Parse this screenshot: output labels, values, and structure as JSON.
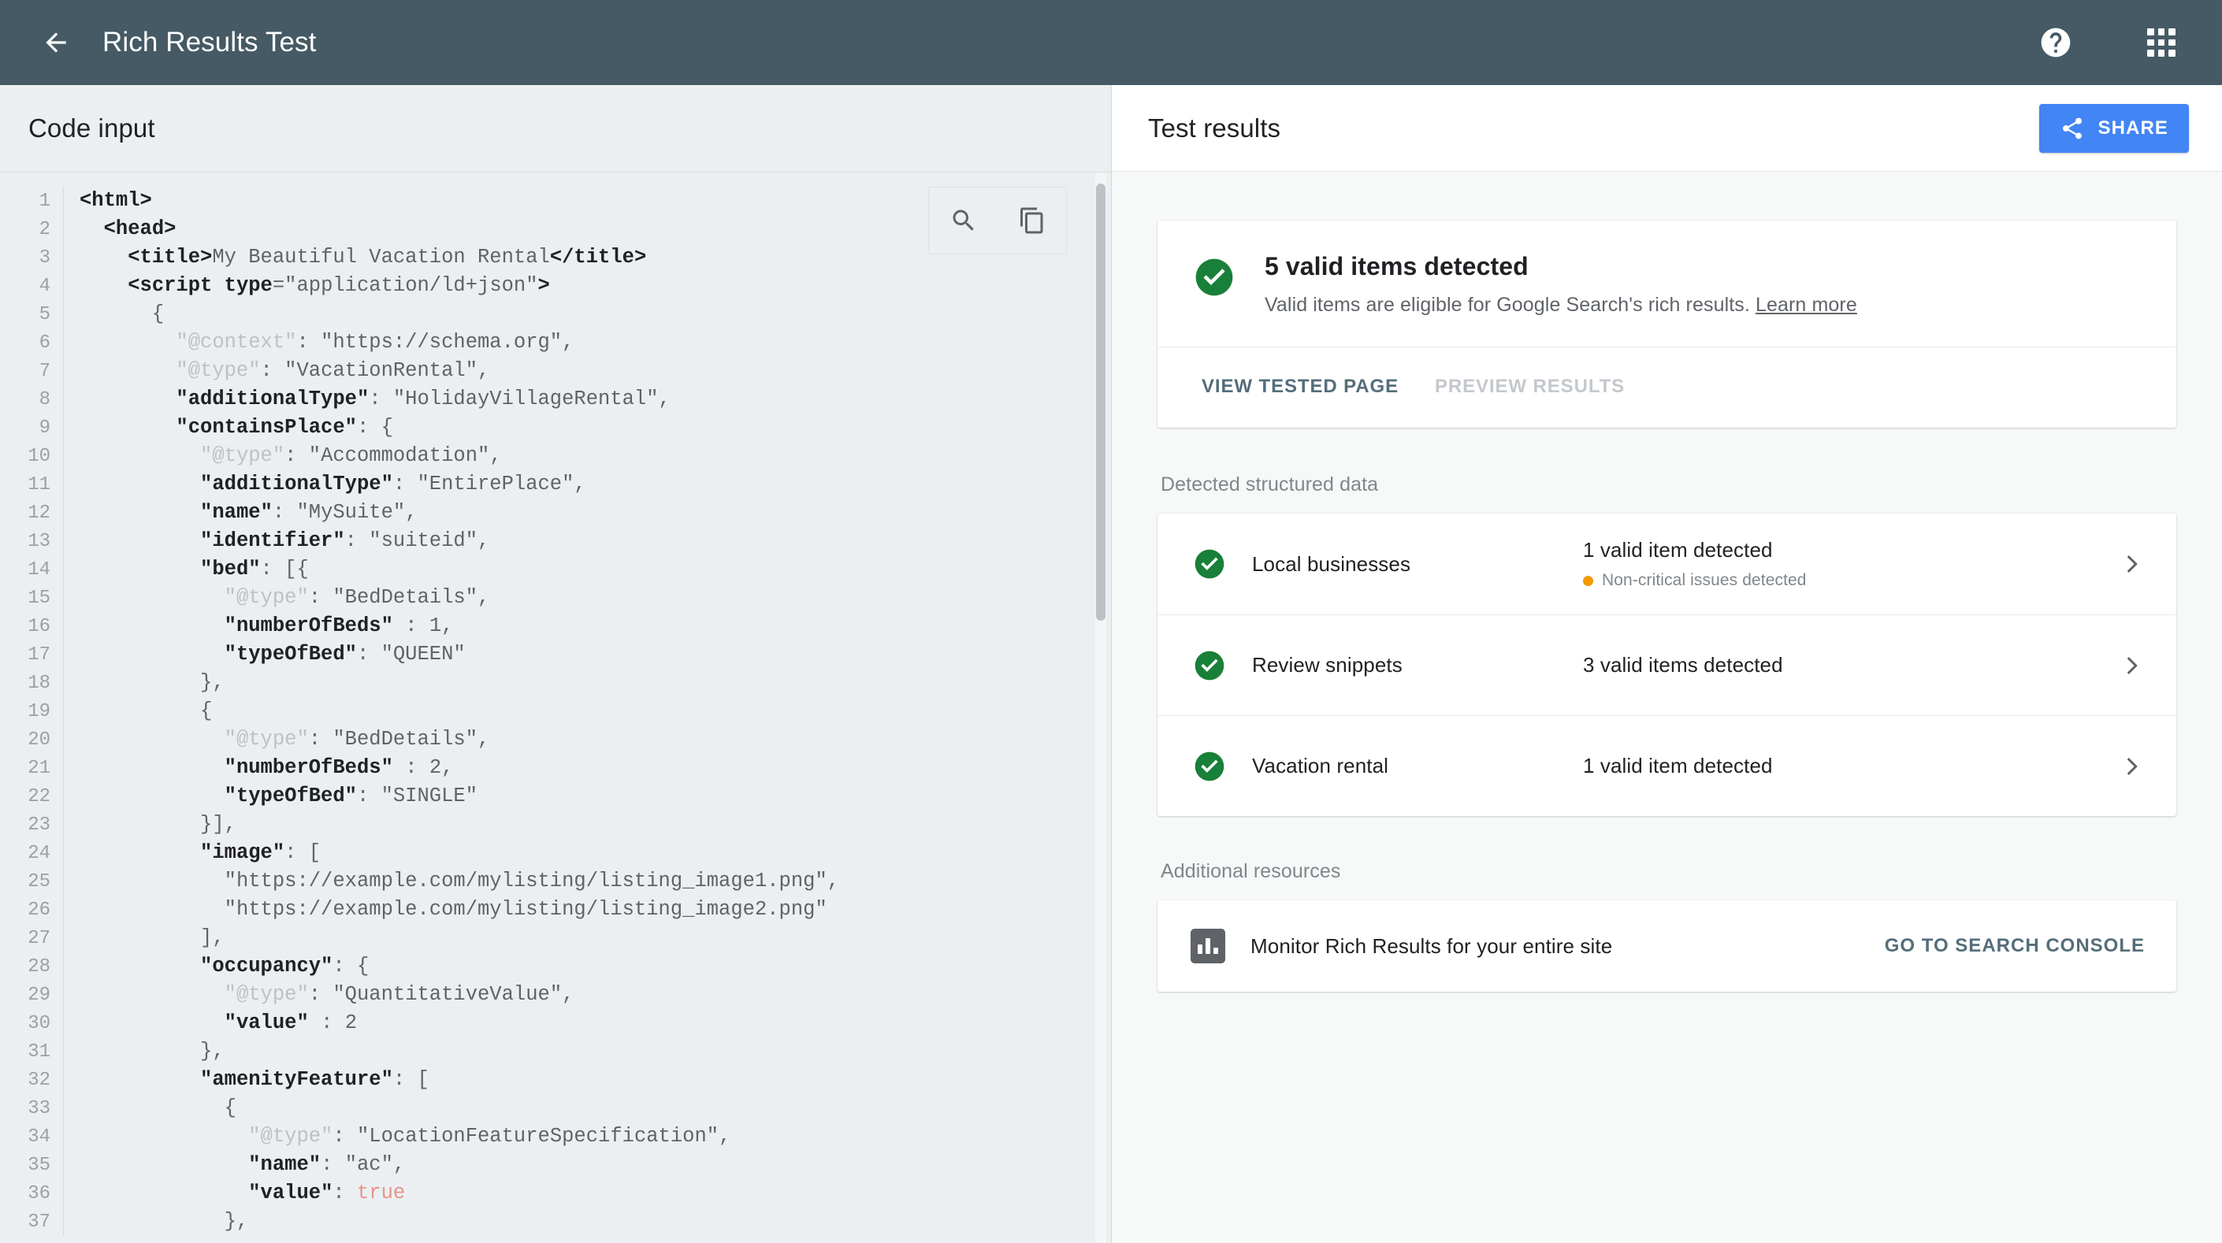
{
  "topbar": {
    "back_icon": "arrow-left-icon",
    "title": "Rich Results Test",
    "help_icon": "help-icon",
    "apps_icon": "apps-grid-icon"
  },
  "code_panel": {
    "header": "Code input",
    "toolbar": {
      "search_icon": "search-icon",
      "copy_icon": "copy-icon"
    },
    "lines": [
      {
        "n": "1",
        "tokens": [
          {
            "t": "tag",
            "v": "<html>"
          }
        ]
      },
      {
        "n": "2",
        "tokens": [
          {
            "t": "plain",
            "v": "  "
          },
          {
            "t": "tag",
            "v": "<head>"
          }
        ]
      },
      {
        "n": "3",
        "tokens": [
          {
            "t": "plain",
            "v": "    "
          },
          {
            "t": "tag",
            "v": "<title>"
          },
          {
            "t": "str",
            "v": "My Beautiful Vacation Rental"
          },
          {
            "t": "tag",
            "v": "</title>"
          }
        ]
      },
      {
        "n": "4",
        "tokens": [
          {
            "t": "plain",
            "v": "    "
          },
          {
            "t": "tag",
            "v": "<script "
          },
          {
            "t": "attr",
            "v": "type"
          },
          {
            "t": "plain",
            "v": "="
          },
          {
            "t": "str",
            "v": "\"application/ld+json\""
          },
          {
            "t": "tag",
            "v": ">"
          }
        ]
      },
      {
        "n": "5",
        "tokens": [
          {
            "t": "plain",
            "v": "      {"
          }
        ]
      },
      {
        "n": "6",
        "tokens": [
          {
            "t": "plain",
            "v": "        "
          },
          {
            "t": "meta",
            "v": "\"@context\""
          },
          {
            "t": "plain",
            "v": ": "
          },
          {
            "t": "str",
            "v": "\"https://schema.org\""
          },
          {
            "t": "plain",
            "v": ","
          }
        ]
      },
      {
        "n": "7",
        "tokens": [
          {
            "t": "plain",
            "v": "        "
          },
          {
            "t": "meta",
            "v": "\"@type\""
          },
          {
            "t": "plain",
            "v": ": "
          },
          {
            "t": "str",
            "v": "\"VacationRental\""
          },
          {
            "t": "plain",
            "v": ","
          }
        ]
      },
      {
        "n": "8",
        "tokens": [
          {
            "t": "plain",
            "v": "        "
          },
          {
            "t": "key",
            "v": "\"additionalType\""
          },
          {
            "t": "plain",
            "v": ": "
          },
          {
            "t": "str",
            "v": "\"HolidayVillageRental\""
          },
          {
            "t": "plain",
            "v": ","
          }
        ]
      },
      {
        "n": "9",
        "tokens": [
          {
            "t": "plain",
            "v": "        "
          },
          {
            "t": "key",
            "v": "\"containsPlace\""
          },
          {
            "t": "plain",
            "v": ": {"
          }
        ]
      },
      {
        "n": "10",
        "tokens": [
          {
            "t": "plain",
            "v": "          "
          },
          {
            "t": "meta",
            "v": "\"@type\""
          },
          {
            "t": "plain",
            "v": ": "
          },
          {
            "t": "str",
            "v": "\"Accommodation\""
          },
          {
            "t": "plain",
            "v": ","
          }
        ]
      },
      {
        "n": "11",
        "tokens": [
          {
            "t": "plain",
            "v": "          "
          },
          {
            "t": "key",
            "v": "\"additionalType\""
          },
          {
            "t": "plain",
            "v": ": "
          },
          {
            "t": "str",
            "v": "\"EntirePlace\""
          },
          {
            "t": "plain",
            "v": ","
          }
        ]
      },
      {
        "n": "12",
        "tokens": [
          {
            "t": "plain",
            "v": "          "
          },
          {
            "t": "key",
            "v": "\"name\""
          },
          {
            "t": "plain",
            "v": ": "
          },
          {
            "t": "str",
            "v": "\"MySuite\""
          },
          {
            "t": "plain",
            "v": ","
          }
        ]
      },
      {
        "n": "13",
        "tokens": [
          {
            "t": "plain",
            "v": "          "
          },
          {
            "t": "key",
            "v": "\"identifier\""
          },
          {
            "t": "plain",
            "v": ": "
          },
          {
            "t": "str",
            "v": "\"suiteid\""
          },
          {
            "t": "plain",
            "v": ","
          }
        ]
      },
      {
        "n": "14",
        "tokens": [
          {
            "t": "plain",
            "v": "          "
          },
          {
            "t": "key",
            "v": "\"bed\""
          },
          {
            "t": "plain",
            "v": ": [{"
          }
        ]
      },
      {
        "n": "15",
        "tokens": [
          {
            "t": "plain",
            "v": "            "
          },
          {
            "t": "meta",
            "v": "\"@type\""
          },
          {
            "t": "plain",
            "v": ": "
          },
          {
            "t": "str",
            "v": "\"BedDetails\""
          },
          {
            "t": "plain",
            "v": ","
          }
        ]
      },
      {
        "n": "16",
        "tokens": [
          {
            "t": "plain",
            "v": "            "
          },
          {
            "t": "key",
            "v": "\"numberOfBeds\""
          },
          {
            "t": "plain",
            "v": " : "
          },
          {
            "t": "num",
            "v": "1"
          },
          {
            "t": "plain",
            "v": ","
          }
        ]
      },
      {
        "n": "17",
        "tokens": [
          {
            "t": "plain",
            "v": "            "
          },
          {
            "t": "key",
            "v": "\"typeOfBed\""
          },
          {
            "t": "plain",
            "v": ": "
          },
          {
            "t": "str",
            "v": "\"QUEEN\""
          }
        ]
      },
      {
        "n": "18",
        "tokens": [
          {
            "t": "plain",
            "v": "          },"
          }
        ]
      },
      {
        "n": "19",
        "tokens": [
          {
            "t": "plain",
            "v": "          {"
          }
        ]
      },
      {
        "n": "20",
        "tokens": [
          {
            "t": "plain",
            "v": "            "
          },
          {
            "t": "meta",
            "v": "\"@type\""
          },
          {
            "t": "plain",
            "v": ": "
          },
          {
            "t": "str",
            "v": "\"BedDetails\""
          },
          {
            "t": "plain",
            "v": ","
          }
        ]
      },
      {
        "n": "21",
        "tokens": [
          {
            "t": "plain",
            "v": "            "
          },
          {
            "t": "key",
            "v": "\"numberOfBeds\""
          },
          {
            "t": "plain",
            "v": " : "
          },
          {
            "t": "num",
            "v": "2"
          },
          {
            "t": "plain",
            "v": ","
          }
        ]
      },
      {
        "n": "22",
        "tokens": [
          {
            "t": "plain",
            "v": "            "
          },
          {
            "t": "key",
            "v": "\"typeOfBed\""
          },
          {
            "t": "plain",
            "v": ": "
          },
          {
            "t": "str",
            "v": "\"SINGLE\""
          }
        ]
      },
      {
        "n": "23",
        "tokens": [
          {
            "t": "plain",
            "v": "          }],"
          }
        ]
      },
      {
        "n": "24",
        "tokens": [
          {
            "t": "plain",
            "v": "          "
          },
          {
            "t": "key",
            "v": "\"image\""
          },
          {
            "t": "plain",
            "v": ": ["
          }
        ]
      },
      {
        "n": "25",
        "tokens": [
          {
            "t": "plain",
            "v": "            "
          },
          {
            "t": "str",
            "v": "\"https://example.com/mylisting/listing_image1.png\""
          },
          {
            "t": "plain",
            "v": ","
          }
        ]
      },
      {
        "n": "26",
        "tokens": [
          {
            "t": "plain",
            "v": "            "
          },
          {
            "t": "str",
            "v": "\"https://example.com/mylisting/listing_image2.png\""
          }
        ]
      },
      {
        "n": "27",
        "tokens": [
          {
            "t": "plain",
            "v": "          ],"
          }
        ]
      },
      {
        "n": "28",
        "tokens": [
          {
            "t": "plain",
            "v": "          "
          },
          {
            "t": "key",
            "v": "\"occupancy\""
          },
          {
            "t": "plain",
            "v": ": {"
          }
        ]
      },
      {
        "n": "29",
        "tokens": [
          {
            "t": "plain",
            "v": "            "
          },
          {
            "t": "meta",
            "v": "\"@type\""
          },
          {
            "t": "plain",
            "v": ": "
          },
          {
            "t": "str",
            "v": "\"QuantitativeValue\""
          },
          {
            "t": "plain",
            "v": ","
          }
        ]
      },
      {
        "n": "30",
        "tokens": [
          {
            "t": "plain",
            "v": "            "
          },
          {
            "t": "key",
            "v": "\"value\""
          },
          {
            "t": "plain",
            "v": " : "
          },
          {
            "t": "num",
            "v": "2"
          }
        ]
      },
      {
        "n": "31",
        "tokens": [
          {
            "t": "plain",
            "v": "          },"
          }
        ]
      },
      {
        "n": "32",
        "tokens": [
          {
            "t": "plain",
            "v": "          "
          },
          {
            "t": "key",
            "v": "\"amenityFeature\""
          },
          {
            "t": "plain",
            "v": ": ["
          }
        ]
      },
      {
        "n": "33",
        "tokens": [
          {
            "t": "plain",
            "v": "            {"
          }
        ]
      },
      {
        "n": "34",
        "tokens": [
          {
            "t": "plain",
            "v": "              "
          },
          {
            "t": "meta",
            "v": "\"@type\""
          },
          {
            "t": "plain",
            "v": ": "
          },
          {
            "t": "str",
            "v": "\"LocationFeatureSpecification\""
          },
          {
            "t": "plain",
            "v": ","
          }
        ]
      },
      {
        "n": "35",
        "tokens": [
          {
            "t": "plain",
            "v": "              "
          },
          {
            "t": "key",
            "v": "\"name\""
          },
          {
            "t": "plain",
            "v": ": "
          },
          {
            "t": "str",
            "v": "\"ac\""
          },
          {
            "t": "plain",
            "v": ","
          }
        ]
      },
      {
        "n": "36",
        "tokens": [
          {
            "t": "plain",
            "v": "              "
          },
          {
            "t": "key",
            "v": "\"value\""
          },
          {
            "t": "plain",
            "v": ": "
          },
          {
            "t": "bool",
            "v": "true"
          }
        ]
      },
      {
        "n": "37",
        "tokens": [
          {
            "t": "plain",
            "v": "            },"
          }
        ]
      }
    ]
  },
  "results_panel": {
    "header": "Test results",
    "share_button": "SHARE",
    "share_icon": "share-icon",
    "summary": {
      "status_icon": "check-circle-icon",
      "title": "5 valid items detected",
      "subtitle": "Valid items are eligible for Google Search's rich results.",
      "learn_more": "Learn more",
      "primary_action": "VIEW TESTED PAGE",
      "secondary_action": "PREVIEW RESULTS"
    },
    "detected_label": "Detected structured data",
    "detected_items": [
      {
        "status_icon": "check-circle-icon",
        "name": "Local businesses",
        "status": "1 valid item detected",
        "note": "Non-critical issues detected",
        "note_dot_color": "#f29900",
        "chevron_icon": "chevron-right-icon"
      },
      {
        "status_icon": "check-circle-icon",
        "name": "Review snippets",
        "status": "3 valid items detected",
        "note": "",
        "chevron_icon": "chevron-right-icon"
      },
      {
        "status_icon": "check-circle-icon",
        "name": "Vacation rental",
        "status": "1 valid item detected",
        "note": "",
        "chevron_icon": "chevron-right-icon"
      }
    ],
    "resources_label": "Additional resources",
    "resource": {
      "icon": "bar-chart-icon",
      "label": "Monitor Rich Results for your entire site",
      "cta": "GO TO SEARCH CONSOLE"
    }
  },
  "colors": {
    "topbar_bg": "#455a64",
    "accent_blue": "#4285f4",
    "valid_green": "#188038",
    "warning_orange": "#f29900",
    "link_slate": "#546e7a"
  }
}
